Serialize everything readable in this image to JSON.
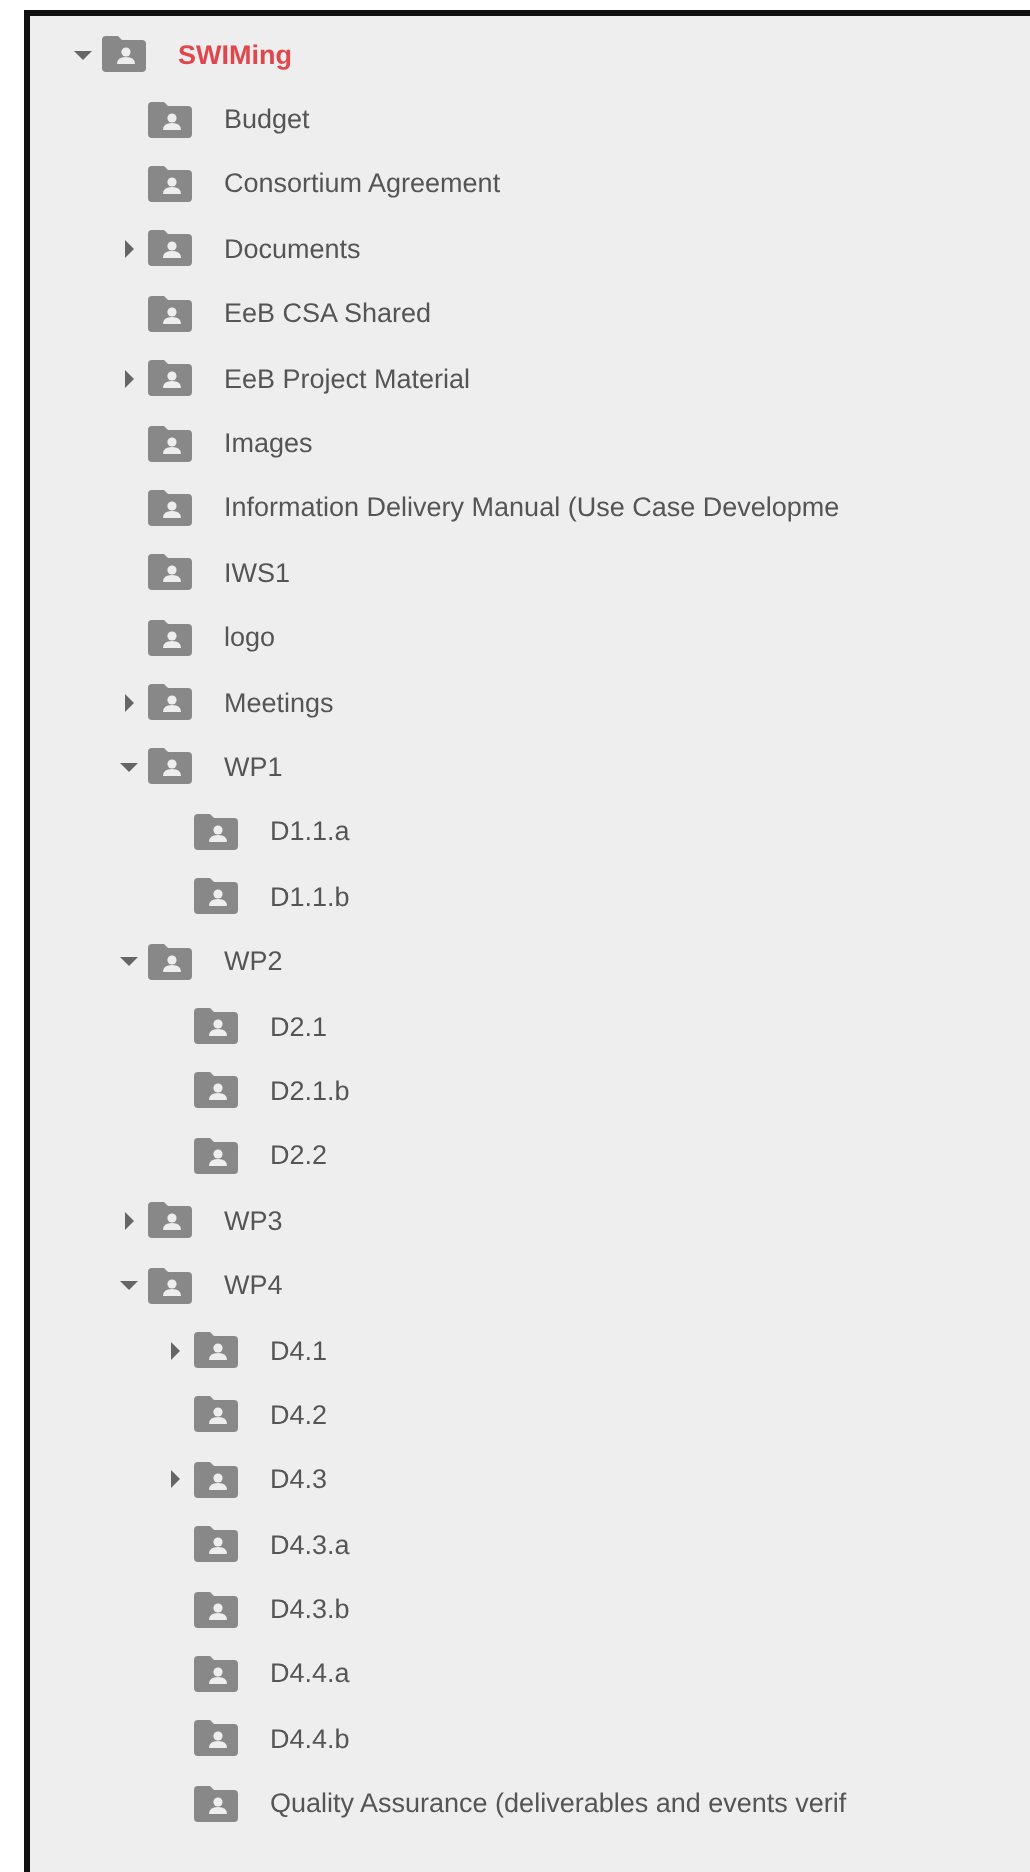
{
  "tree": [
    {
      "label": "SWIMing",
      "kind": "root",
      "expanded": true,
      "children": [
        {
          "label": "Budget"
        },
        {
          "label": "Consortium Agreement"
        },
        {
          "label": "Documents",
          "expanded": false
        },
        {
          "label": "EeB CSA Shared"
        },
        {
          "label": "EeB Project Material",
          "expanded": false
        },
        {
          "label": "Images"
        },
        {
          "label": "Information Delivery Manual (Use Case Developme"
        },
        {
          "label": "IWS1"
        },
        {
          "label": "logo"
        },
        {
          "label": "Meetings",
          "expanded": false
        },
        {
          "label": "WP1",
          "expanded": true,
          "children": [
            {
              "label": "D1.1.a"
            },
            {
              "label": "D1.1.b"
            }
          ]
        },
        {
          "label": "WP2",
          "expanded": true,
          "children": [
            {
              "label": "D2.1"
            },
            {
              "label": "D2.1.b"
            },
            {
              "label": "D2.2"
            }
          ]
        },
        {
          "label": "WP3",
          "expanded": false
        },
        {
          "label": "WP4",
          "expanded": true,
          "children": [
            {
              "label": "D4.1",
              "expanded": false
            },
            {
              "label": "D4.2"
            },
            {
              "label": "D4.3",
              "expanded": false
            },
            {
              "label": "D4.3.a"
            },
            {
              "label": "D4.3.b"
            },
            {
              "label": "D4.4.a"
            },
            {
              "label": "D4.4.b"
            },
            {
              "label": "Quality Assurance (deliverables and events verif"
            }
          ]
        }
      ]
    }
  ]
}
